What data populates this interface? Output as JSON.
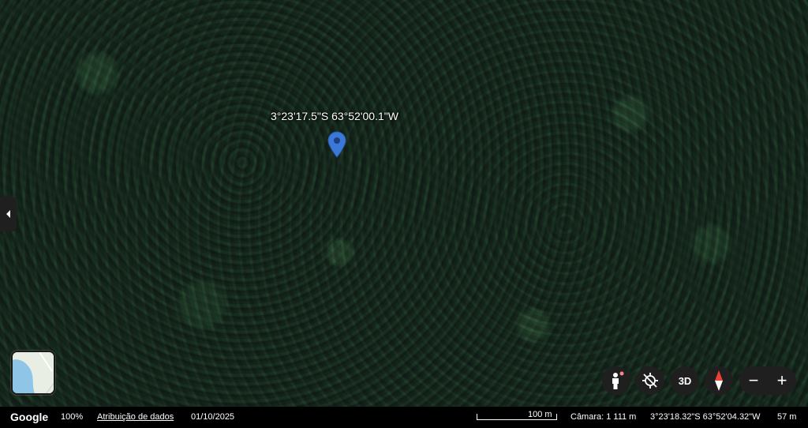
{
  "map": {
    "marker_label": "3°23'17.5\"S 63°52'00.1\"W",
    "marker_icon": "location-pin-icon",
    "marker_color": "#3c78d8"
  },
  "controls": {
    "sidebar_toggle_icon": "chevron-left-icon",
    "layer_thumbnail_icon": "map-layer-icon",
    "street_view_icon": "pegman-icon",
    "recenter_icon": "location-off-icon",
    "btn_3d": "3D",
    "compass_icon": "compass-icon",
    "zoom_out": "−",
    "zoom_in": "+"
  },
  "status_bar": {
    "logo": "Google",
    "zoom_percent": "100%",
    "attribution": "Atribuição de dados",
    "imagery_date": "01/10/2025",
    "scale_label": "100 m",
    "camera": "Câmara: 1 111 m",
    "cursor_coords": "3°23'18.32\"S 63°52'04.32\"W",
    "elevation": "57 m"
  }
}
